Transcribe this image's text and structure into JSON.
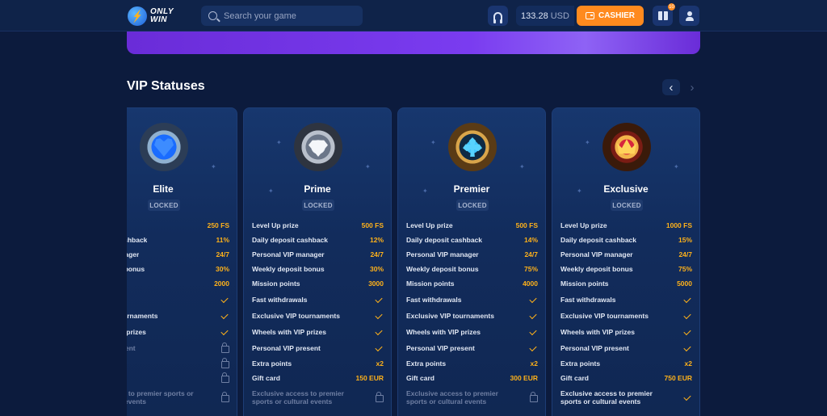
{
  "header": {
    "logo_line1": "ONLY",
    "logo_line2": "WIN",
    "search_placeholder": "Search your game",
    "balance_amount": "133.28",
    "balance_currency": "USD",
    "cashier_label": "CASHIER",
    "gift_count": "10"
  },
  "section": {
    "title": "VIP Statuses"
  },
  "cards": [
    {
      "name": "Elite",
      "status": "LOCKED",
      "rows": [
        {
          "label": "prize",
          "value": "250 FS"
        },
        {
          "label": "posit cashback",
          "value": "11%"
        },
        {
          "label": "VIP manager",
          "value": "24/7"
        },
        {
          "label": "deposit bonus",
          "value": "30%"
        },
        {
          "label": "points",
          "value": "2000"
        },
        {
          "label": "drawals"
        },
        {
          "label": "e VIP tournaments"
        },
        {
          "label": "with VIP prizes"
        },
        {
          "label": "VIP present"
        },
        {
          "label": "nts"
        },
        {
          "label": ""
        },
        {
          "label": "e access to premier sports or cultural events"
        }
      ]
    },
    {
      "name": "Prime",
      "status": "LOCKED",
      "rows": [
        {
          "label": "Level Up prize",
          "value": "500 FS"
        },
        {
          "label": "Daily deposit cashback",
          "value": "12%"
        },
        {
          "label": "Personal VIP manager",
          "value": "24/7"
        },
        {
          "label": "Weekly deposit bonus",
          "value": "30%"
        },
        {
          "label": "Mission points",
          "value": "3000"
        },
        {
          "label": "Fast withdrawals"
        },
        {
          "label": "Exclusive VIP tournaments"
        },
        {
          "label": "Wheels with VIP prizes"
        },
        {
          "label": "Personal VIP present"
        },
        {
          "label": "Extra points",
          "value": "x2"
        },
        {
          "label": "Gift card",
          "value": "150 EUR"
        },
        {
          "label": "Exclusive access to premier sports or cultural events"
        }
      ]
    },
    {
      "name": "Premier",
      "status": "LOCKED",
      "rows": [
        {
          "label": "Level Up prize",
          "value": "500 FS"
        },
        {
          "label": "Daily deposit cashback",
          "value": "14%"
        },
        {
          "label": "Personal VIP manager",
          "value": "24/7"
        },
        {
          "label": "Weekly deposit bonus",
          "value": "75%"
        },
        {
          "label": "Mission points",
          "value": "4000"
        },
        {
          "label": "Fast withdrawals"
        },
        {
          "label": "Exclusive VIP tournaments"
        },
        {
          "label": "Wheels with VIP prizes"
        },
        {
          "label": "Personal VIP present"
        },
        {
          "label": "Extra points",
          "value": "x2"
        },
        {
          "label": "Gift card",
          "value": "300 EUR"
        },
        {
          "label": "Exclusive access to premier sports or cultural events"
        }
      ]
    },
    {
      "name": "Exclusive",
      "status": "LOCKED",
      "rows": [
        {
          "label": "Level Up prize",
          "value": "1000 FS"
        },
        {
          "label": "Daily deposit cashback",
          "value": "15%"
        },
        {
          "label": "Personal VIP manager",
          "value": "24/7"
        },
        {
          "label": "Weekly deposit bonus",
          "value": "75%"
        },
        {
          "label": "Mission points",
          "value": "5000"
        },
        {
          "label": "Fast withdrawals"
        },
        {
          "label": "Exclusive VIP tournaments"
        },
        {
          "label": "Wheels with VIP prizes"
        },
        {
          "label": "Personal VIP present"
        },
        {
          "label": "Extra points",
          "value": "x2"
        },
        {
          "label": "Gift card",
          "value": "750 EUR"
        },
        {
          "label": "Exclusive access to premier sports or cultural events"
        }
      ]
    }
  ]
}
